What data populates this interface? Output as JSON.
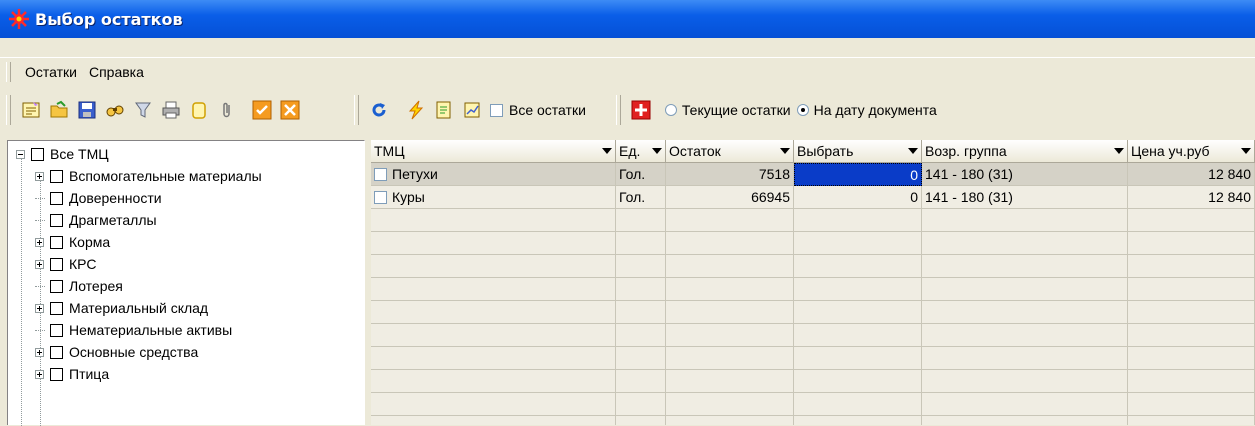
{
  "window": {
    "title": "Выбор остатков"
  },
  "menu": [
    "Остатки",
    "Справка"
  ],
  "toolbar": {
    "icons": [
      "new-doc-icon",
      "open-folder-icon",
      "save-icon",
      "binoculars-icon",
      "filter-icon",
      "print-icon",
      "copy-icon",
      "attach-icon",
      "check-all-icon",
      "uncheck-all-icon",
      "refresh-icon",
      "lightning-icon",
      "edit-doc-icon",
      "report-icon",
      "add-icon"
    ],
    "all_remains_label": "Все остатки",
    "radio_current_label": "Текущие остатки",
    "radio_date_label": "На дату документа",
    "selected_radio": "На дату документа"
  },
  "tree": {
    "root": "Все ТМЦ",
    "items": [
      {
        "label": "Вспомогательные материалы",
        "expandable": true
      },
      {
        "label": "Доверенности",
        "expandable": false
      },
      {
        "label": "Драгметаллы",
        "expandable": false
      },
      {
        "label": "Корма",
        "expandable": true
      },
      {
        "label": "КРС",
        "expandable": true
      },
      {
        "label": "Лотерея",
        "expandable": false
      },
      {
        "label": "Материальный склад",
        "expandable": true
      },
      {
        "label": "Нематериальные активы",
        "expandable": false
      },
      {
        "label": "Основные средства",
        "expandable": true
      },
      {
        "label": "Птица",
        "expandable": true
      }
    ]
  },
  "grid": {
    "columns": [
      "ТМЦ",
      "Ед.",
      "Остаток",
      "Выбрать",
      "Возр. группа",
      "Цена уч.руб"
    ],
    "rows": [
      [
        "Петухи",
        "Гол.",
        "7518",
        "0",
        "141 - 180 (31)",
        "12 840"
      ],
      [
        "Куры",
        "Гол.",
        "66945",
        "0",
        "141 - 180 (31)",
        "12 840"
      ]
    ]
  }
}
